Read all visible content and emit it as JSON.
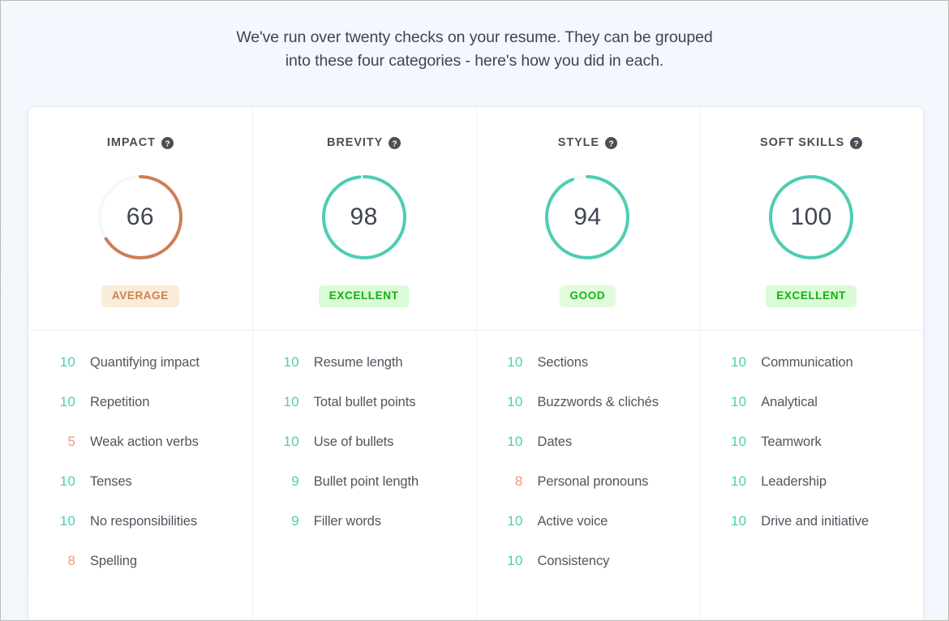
{
  "intro": {
    "line1": "We've run over twenty checks on your resume. They can be grouped",
    "line2": "into these four categories - here's how you did in each."
  },
  "colors": {
    "teal": "#4ecdb4",
    "orange": "#cd7f58",
    "score_good": "#4ecdb4",
    "score_warn": "#ef9a7a",
    "badge_excellent_bg": "#d9fcd6",
    "badge_excellent_fg": "#13ae16",
    "badge_good_bg": "#e2fbdd",
    "badge_good_fg": "#18b51c",
    "badge_average_bg": "#fbecd9",
    "badge_average_fg": "#cb8250",
    "page_bg": "#f3f6fd",
    "card_bg": "#ffffff",
    "divider": "#eef0f5",
    "track": "#f7f7f8"
  },
  "help_icon_name": "help-circle-icon",
  "categories": [
    {
      "title": "IMPACT",
      "score": 66,
      "score_text": "66",
      "ring_color": "#cd7f58",
      "badge": "AVERAGE",
      "badge_bg": "#fbecd9",
      "badge_fg": "#cb8250",
      "checks": [
        {
          "score": "10",
          "label": "Quantifying impact",
          "color": "#4ecdb4"
        },
        {
          "score": "10",
          "label": "Repetition",
          "color": "#4ecdb4"
        },
        {
          "score": "5",
          "label": "Weak action verbs",
          "color": "#ef9a7a"
        },
        {
          "score": "10",
          "label": "Tenses",
          "color": "#4ecdb4"
        },
        {
          "score": "10",
          "label": "No responsibilities",
          "color": "#4ecdb4"
        },
        {
          "score": "8",
          "label": "Spelling",
          "color": "#ef9a7a"
        }
      ]
    },
    {
      "title": "BREVITY",
      "score": 98,
      "score_text": "98",
      "ring_color": "#4ecdb4",
      "badge": "EXCELLENT",
      "badge_bg": "#d9fcd6",
      "badge_fg": "#13ae16",
      "checks": [
        {
          "score": "10",
          "label": "Resume length",
          "color": "#4ecdb4"
        },
        {
          "score": "10",
          "label": "Total bullet points",
          "color": "#4ecdb4"
        },
        {
          "score": "10",
          "label": "Use of bullets",
          "color": "#4ecdb4"
        },
        {
          "score": "9",
          "label": "Bullet point length",
          "color": "#4ecdb4"
        },
        {
          "score": "9",
          "label": "Filler words",
          "color": "#4ecdb4"
        }
      ]
    },
    {
      "title": "STYLE",
      "score": 94,
      "score_text": "94",
      "ring_color": "#4ecdb4",
      "badge": "GOOD",
      "badge_bg": "#e2fbdd",
      "badge_fg": "#18b51c",
      "checks": [
        {
          "score": "10",
          "label": "Sections",
          "color": "#4ecdb4"
        },
        {
          "score": "10",
          "label": "Buzzwords & clichés",
          "color": "#4ecdb4"
        },
        {
          "score": "10",
          "label": "Dates",
          "color": "#4ecdb4"
        },
        {
          "score": "8",
          "label": "Personal pronouns",
          "color": "#ef9a7a"
        },
        {
          "score": "10",
          "label": "Active voice",
          "color": "#4ecdb4"
        },
        {
          "score": "10",
          "label": "Consistency",
          "color": "#4ecdb4"
        }
      ]
    },
    {
      "title": "SOFT SKILLS",
      "score": 100,
      "score_text": "100",
      "ring_color": "#4ecdb4",
      "badge": "EXCELLENT",
      "badge_bg": "#d9fcd6",
      "badge_fg": "#13ae16",
      "checks": [
        {
          "score": "10",
          "label": "Communication",
          "color": "#4ecdb4"
        },
        {
          "score": "10",
          "label": "Analytical",
          "color": "#4ecdb4"
        },
        {
          "score": "10",
          "label": "Teamwork",
          "color": "#4ecdb4"
        },
        {
          "score": "10",
          "label": "Leadership",
          "color": "#4ecdb4"
        },
        {
          "score": "10",
          "label": "Drive and initiative",
          "color": "#4ecdb4"
        }
      ]
    }
  ],
  "chart_data": {
    "type": "pie",
    "title": "Resume check scores by category",
    "categories": [
      "IMPACT",
      "BREVITY",
      "STYLE",
      "SOFT SKILLS"
    ],
    "values": [
      66,
      98,
      94,
      100
    ],
    "ylim": [
      0,
      100
    ],
    "annotations": [
      "AVERAGE",
      "EXCELLENT",
      "GOOD",
      "EXCELLENT"
    ]
  }
}
